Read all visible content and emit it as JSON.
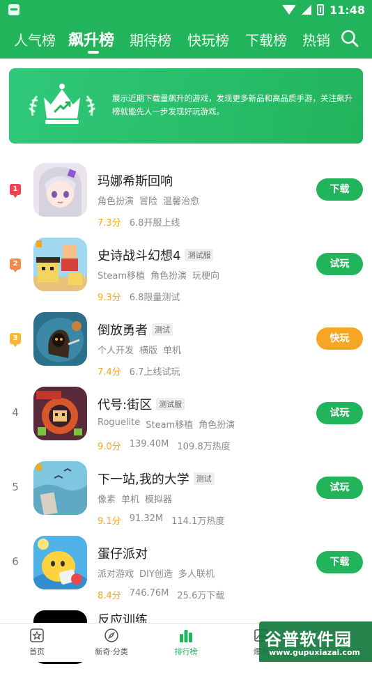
{
  "status": {
    "time": "11:48"
  },
  "tabs": [
    {
      "label": "人气榜",
      "active": false
    },
    {
      "label": "飙升榜",
      "active": true
    },
    {
      "label": "期待榜",
      "active": false
    },
    {
      "label": "快玩榜",
      "active": false
    },
    {
      "label": "下载榜",
      "active": false
    },
    {
      "label": "热销",
      "active": false
    }
  ],
  "banner": {
    "text": "展示近期下载量飙升的游戏，发现更多新品和高品质手游，关注飙升榜就能先人一步发现好玩游戏。"
  },
  "games": [
    {
      "rank": "1",
      "name": "玛娜希斯回响",
      "test_tag": "",
      "tags": [
        "角色扮演",
        "冒险",
        "温馨治愈"
      ],
      "score": "7.3分",
      "meta": [
        "6.8开服上线"
      ],
      "action": "下载",
      "action_color": "#22b45b",
      "badge_color": "#f0424f"
    },
    {
      "rank": "2",
      "name": "史诗战斗幻想4",
      "test_tag": "测试服",
      "tags": [
        "Steam移植",
        "角色扮演",
        "玩梗向"
      ],
      "score": "9.3分",
      "meta": [
        "6.8限量测试"
      ],
      "action": "试玩",
      "action_color": "#22b45b",
      "badge_color": "#f5894a"
    },
    {
      "rank": "3",
      "name": "倒放勇者",
      "test_tag": "测试",
      "tags": [
        "个人开发",
        "横版",
        "单机"
      ],
      "score": "7.4分",
      "meta": [
        "6.7上线试玩"
      ],
      "action": "快玩",
      "action_color": "#f5a623",
      "badge_color": "#f7b731"
    },
    {
      "rank": "4",
      "name": "代号:街区",
      "test_tag": "测试服",
      "tags": [
        "Roguelite",
        "Steam移植",
        "角色扮演"
      ],
      "score": "9.0分",
      "meta": [
        "139.40M",
        "109.8万热度"
      ],
      "action": "试玩",
      "action_color": "#22b45b",
      "badge_color": ""
    },
    {
      "rank": "5",
      "name": "下一站,我的大学",
      "test_tag": "测试",
      "tags": [
        "像素",
        "单机",
        "模拟器"
      ],
      "score": "9.1分",
      "meta": [
        "91.32M",
        "114.1万热度"
      ],
      "action": "试玩",
      "action_color": "#22b45b",
      "badge_color": ""
    },
    {
      "rank": "6",
      "name": "蛋仔派对",
      "test_tag": "",
      "tags": [
        "派对游戏",
        "DIY创造",
        "多人联机"
      ],
      "score": "8.4分",
      "meta": [
        "746.76M",
        "25.6万下载"
      ],
      "action": "下载",
      "action_color": "#22b45b",
      "badge_color": ""
    },
    {
      "rank": "",
      "name": "反应训练",
      "test_tag": "",
      "tags": [],
      "score": "",
      "meta": [],
      "action": "",
      "action_color": "",
      "badge_color": ""
    }
  ],
  "bottom_nav": [
    {
      "label": "首页",
      "icon": "star-page-icon",
      "active": false
    },
    {
      "label": "新奇·分类",
      "icon": "compass-icon",
      "active": false
    },
    {
      "label": "排行榜",
      "icon": "bar-chart-icon",
      "active": true
    },
    {
      "label": "爆友",
      "icon": "image-icon",
      "active": false
    }
  ],
  "watermark": {
    "title": "谷普软件园",
    "url": "www.gupuxiazai.com"
  }
}
